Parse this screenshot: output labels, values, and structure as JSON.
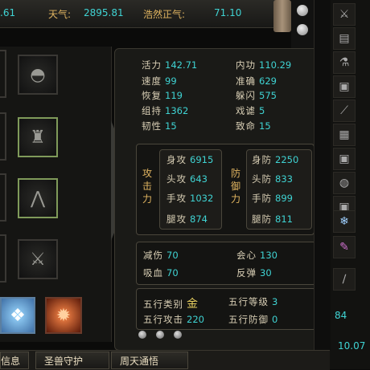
{
  "top": {
    "partial_value": ".61",
    "tianqi_label": "天气:",
    "tianqi_value": "2895.81",
    "haoran_label": "浩然正气:",
    "haoran_value": "71.10"
  },
  "basic_stats": [
    {
      "label": "活力",
      "value": "142.71"
    },
    {
      "label": "内功",
      "value": "110.29"
    },
    {
      "label": "速度",
      "value": "99"
    },
    {
      "label": "准确",
      "value": "629"
    },
    {
      "label": "恢复",
      "value": "119"
    },
    {
      "label": "躲闪",
      "value": "575"
    },
    {
      "label": "组持",
      "value": "1362"
    },
    {
      "label": "戏谑",
      "value": "5"
    },
    {
      "label": "韧性",
      "value": "15"
    },
    {
      "label": "致命",
      "value": "15"
    }
  ],
  "attack": {
    "title_chars": [
      "攻",
      "击",
      "力"
    ],
    "items": [
      {
        "label": "身攻",
        "value": "6915"
      },
      {
        "label": "头攻",
        "value": "643"
      },
      {
        "label": "手攻",
        "value": "1032"
      },
      {
        "label": "腿攻",
        "value": "874"
      }
    ]
  },
  "defense": {
    "title_chars": [
      "防",
      "御",
      "力"
    ],
    "items": [
      {
        "label": "身防",
        "value": "2250"
      },
      {
        "label": "头防",
        "value": "833"
      },
      {
        "label": "手防",
        "value": "899"
      },
      {
        "label": "腿防",
        "value": "811"
      }
    ]
  },
  "misc_stats": [
    {
      "label": "减伤",
      "value": "70"
    },
    {
      "label": "会心",
      "value": "130"
    },
    {
      "label": "吸血",
      "value": "70"
    },
    {
      "label": "反弹",
      "value": "30"
    }
  ],
  "five_elements": [
    {
      "label": "五行类别",
      "value": "金"
    },
    {
      "label": "五行等级",
      "value": "3"
    },
    {
      "label": "五行攻击",
      "value": "220"
    },
    {
      "label": "五行防御",
      "value": "0"
    }
  ],
  "right_panel": {
    "value1": "84",
    "value2": "10.07"
  },
  "tabs": [
    {
      "label": "信息"
    },
    {
      "label": "圣兽守护"
    },
    {
      "label": "周天通悟"
    }
  ],
  "colors": {
    "value": "#3fd3d3",
    "title": "#e0b460",
    "label": "#d9cfb5"
  }
}
